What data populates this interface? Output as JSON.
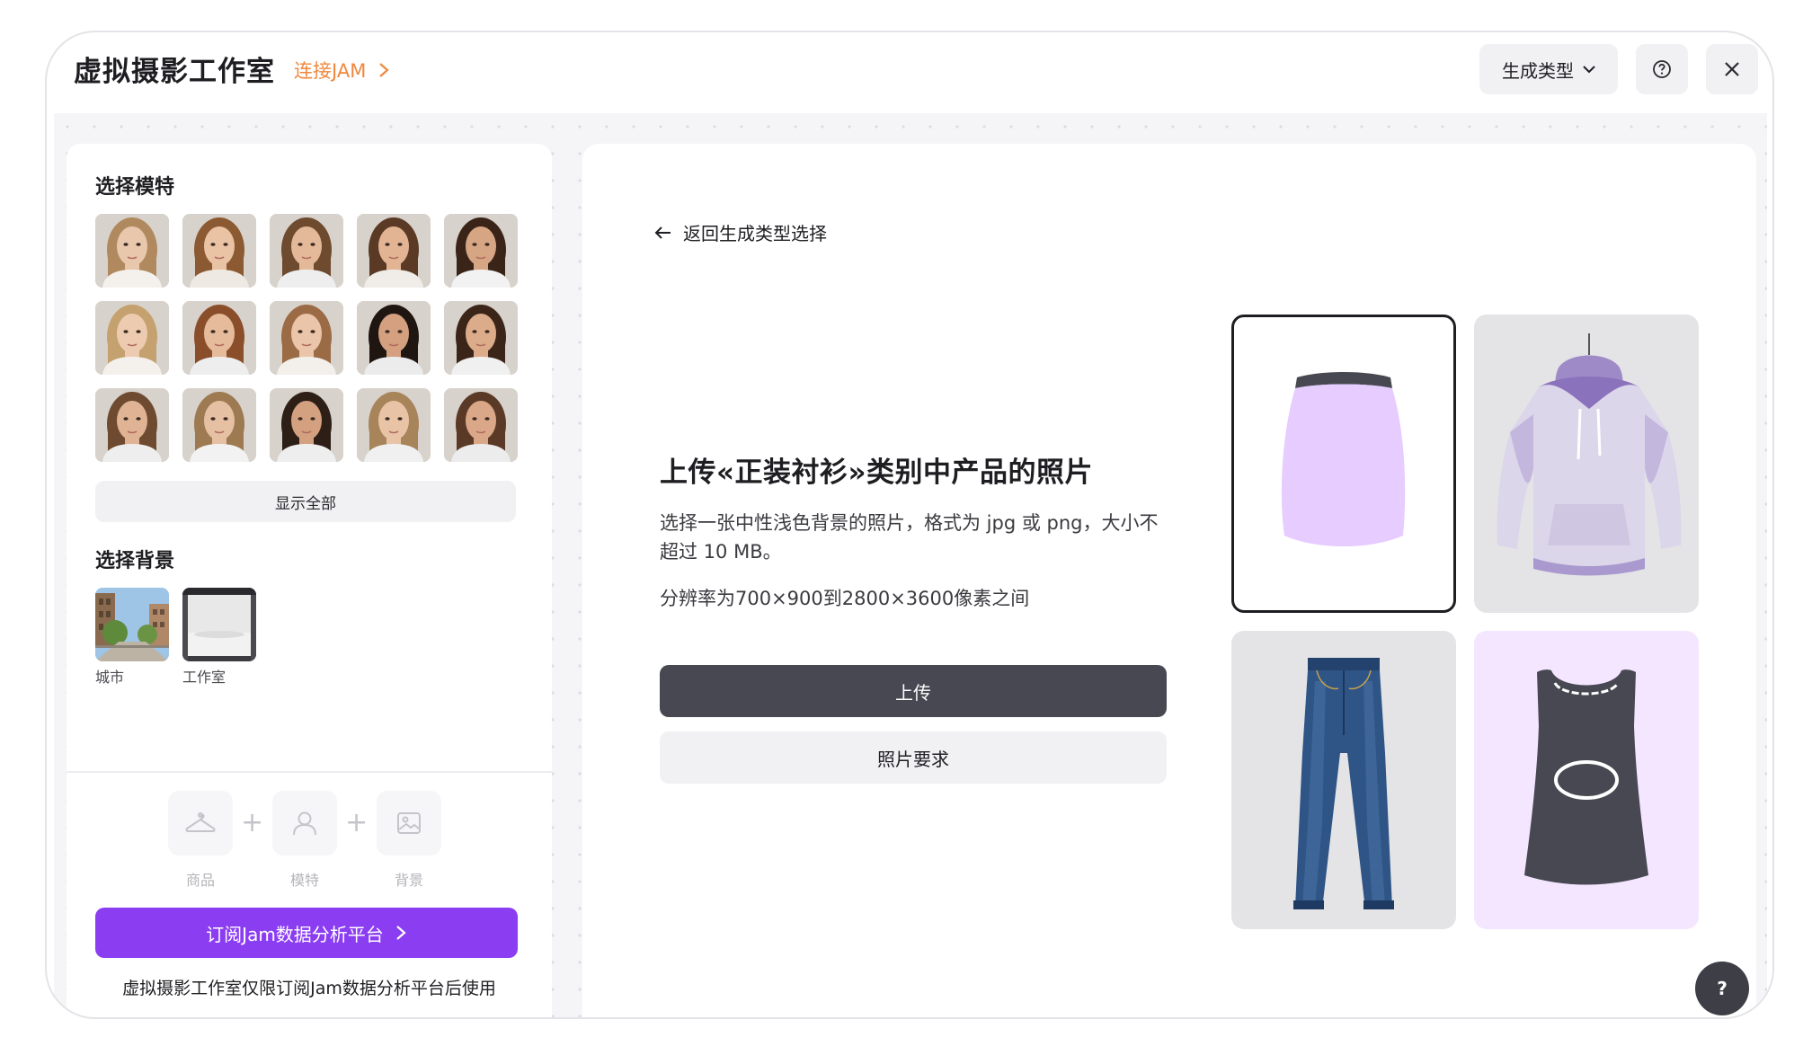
{
  "header": {
    "title": "虚拟摄影工作室",
    "connect_label": "连接JAM",
    "generate_type_label": "生成类型",
    "help_icon": "question-circle-icon",
    "close_icon": "close-icon"
  },
  "sidebar": {
    "models_title": "选择模特",
    "models": [
      {
        "name": "model-1",
        "hair": "#b08a5e",
        "skin": "#e9c7ad",
        "shirt": "#f4f0ec"
      },
      {
        "name": "model-2",
        "hair": "#8c5a32",
        "skin": "#eac2a4",
        "shirt": "#efe9e3"
      },
      {
        "name": "model-3",
        "hair": "#6e4a2e",
        "skin": "#e4b999",
        "shirt": "#eeeeee"
      },
      {
        "name": "model-4",
        "hair": "#5a3a24",
        "skin": "#e2b494",
        "shirt": "#f0ece8"
      },
      {
        "name": "model-5",
        "hair": "#3a2418",
        "skin": "#d6a584",
        "shirt": "#f2f2f2"
      },
      {
        "name": "model-6",
        "hair": "#c4a16e",
        "skin": "#edcbb0",
        "shirt": "#f4f0ec"
      },
      {
        "name": "model-7",
        "hair": "#8a4f2a",
        "skin": "#e6bb9b",
        "shirt": "#eeeeee"
      },
      {
        "name": "model-8",
        "hair": "#9b6b45",
        "skin": "#eac5a9",
        "shirt": "#f3efeb"
      },
      {
        "name": "model-9",
        "hair": "#1f1612",
        "skin": "#d4a080",
        "shirt": "#ececec"
      },
      {
        "name": "model-10",
        "hair": "#3b2519",
        "skin": "#dcab8a",
        "shirt": "#f0f0f0"
      },
      {
        "name": "model-11",
        "hair": "#6e4a30",
        "skin": "#e0b394",
        "shirt": "#eeeeee"
      },
      {
        "name": "model-12",
        "hair": "#9d7a52",
        "skin": "#e6c0a2",
        "shirt": "#f2f2f2"
      },
      {
        "name": "model-13",
        "hair": "#2e1f16",
        "skin": "#d3a080",
        "shirt": "#eeeeee"
      },
      {
        "name": "model-14",
        "hair": "#a8845a",
        "skin": "#e8c3a6",
        "shirt": "#f0f0f0"
      },
      {
        "name": "model-15",
        "hair": "#5a3a26",
        "skin": "#daa888",
        "shirt": "#ececec"
      }
    ],
    "show_all_label": "显示全部",
    "backgrounds_title": "选择背景",
    "backgrounds": [
      {
        "label": "城市"
      },
      {
        "label": "工作室"
      }
    ],
    "steps": [
      {
        "label": "商品",
        "icon": "hanger-icon"
      },
      {
        "label": "模特",
        "icon": "person-icon"
      },
      {
        "label": "背景",
        "icon": "image-icon"
      }
    ],
    "plus_sign": "+",
    "subscribe_label": "订阅Jam数据分析平台",
    "subscribe_note": "虚拟摄影工作室仅限订阅Jam数据分析平台后使用"
  },
  "main": {
    "back_label": "返回生成类型选择",
    "upload_title": "上传«正装衬衫»类别中产品的照片",
    "upload_desc": "选择一张中性浅色背景的照片，格式为 jpg 或 png，大小不超过 10 MB。",
    "upload_resolution": "分辨率为700×900到2800×3600像素之间",
    "upload_button": "上传",
    "requirements_button": "照片要求",
    "product_types": [
      "skirt",
      "hoodie",
      "jeans",
      "tank-top"
    ],
    "float_help_label": "?"
  },
  "colors": {
    "accent_purple": "#8b3df2",
    "connect_orange": "#f0883e",
    "dark_button": "#484852",
    "skirt_lilac": "#e6ccff"
  }
}
